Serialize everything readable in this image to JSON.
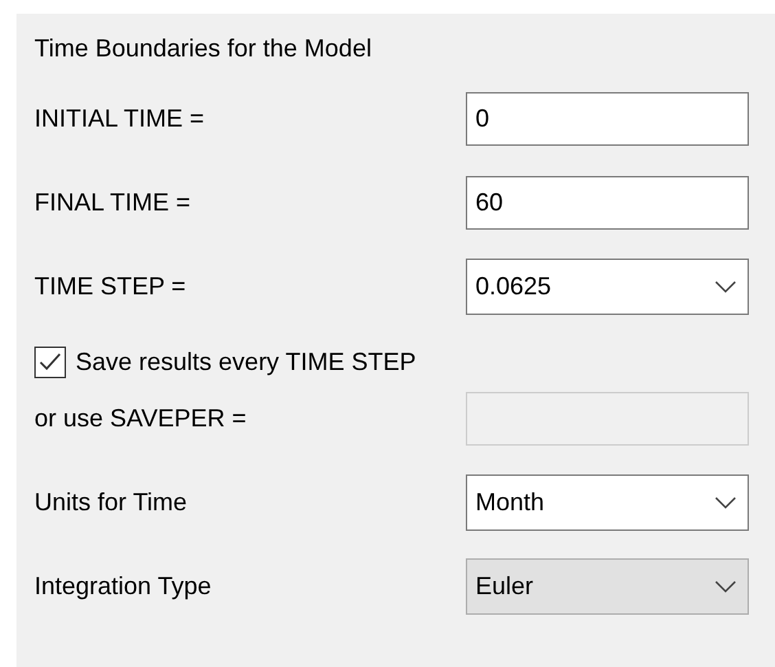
{
  "panel": {
    "title": "Time Boundaries for the Model"
  },
  "rows": [
    {
      "kind": "text",
      "label": "INITIAL TIME =",
      "value": "0"
    },
    {
      "kind": "text",
      "label": "FINAL TIME =",
      "value": "60"
    },
    {
      "kind": "combo",
      "label": "TIME STEP =",
      "value": "0.0625"
    },
    {
      "kind": "checkbox",
      "label": "Save results every TIME STEP",
      "checked": true
    },
    {
      "kind": "text",
      "label": "or use SAVEPER =",
      "disabled": true
    },
    {
      "kind": "combo",
      "label": "Units for Time",
      "value": "Month"
    },
    {
      "kind": "dropdown",
      "label": "Integration Type",
      "value": "Euler"
    }
  ]
}
